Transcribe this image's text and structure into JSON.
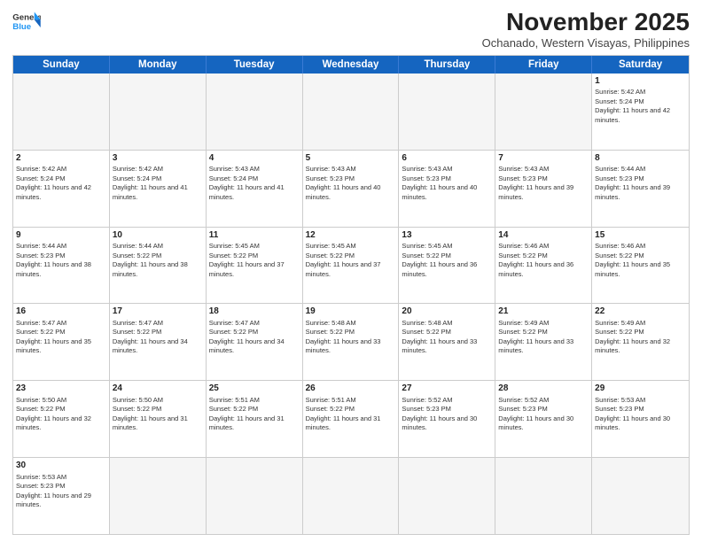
{
  "logo": {
    "line1": "General",
    "line2": "Blue"
  },
  "title": "November 2025",
  "location": "Ochanado, Western Visayas, Philippines",
  "header_days": [
    "Sunday",
    "Monday",
    "Tuesday",
    "Wednesday",
    "Thursday",
    "Friday",
    "Saturday"
  ],
  "weeks": [
    [
      {
        "day": "",
        "empty": true
      },
      {
        "day": "",
        "empty": true
      },
      {
        "day": "",
        "empty": true
      },
      {
        "day": "",
        "empty": true
      },
      {
        "day": "",
        "empty": true
      },
      {
        "day": "",
        "empty": true
      },
      {
        "day": "1",
        "sunrise": "5:42 AM",
        "sunset": "5:24 PM",
        "daylight": "11 hours and 42 minutes."
      }
    ],
    [
      {
        "day": "2",
        "sunrise": "5:42 AM",
        "sunset": "5:24 PM",
        "daylight": "11 hours and 42 minutes."
      },
      {
        "day": "3",
        "sunrise": "5:42 AM",
        "sunset": "5:24 PM",
        "daylight": "11 hours and 41 minutes."
      },
      {
        "day": "4",
        "sunrise": "5:43 AM",
        "sunset": "5:24 PM",
        "daylight": "11 hours and 41 minutes."
      },
      {
        "day": "5",
        "sunrise": "5:43 AM",
        "sunset": "5:23 PM",
        "daylight": "11 hours and 40 minutes."
      },
      {
        "day": "6",
        "sunrise": "5:43 AM",
        "sunset": "5:23 PM",
        "daylight": "11 hours and 40 minutes."
      },
      {
        "day": "7",
        "sunrise": "5:43 AM",
        "sunset": "5:23 PM",
        "daylight": "11 hours and 39 minutes."
      },
      {
        "day": "8",
        "sunrise": "5:44 AM",
        "sunset": "5:23 PM",
        "daylight": "11 hours and 39 minutes."
      }
    ],
    [
      {
        "day": "9",
        "sunrise": "5:44 AM",
        "sunset": "5:23 PM",
        "daylight": "11 hours and 38 minutes."
      },
      {
        "day": "10",
        "sunrise": "5:44 AM",
        "sunset": "5:22 PM",
        "daylight": "11 hours and 38 minutes."
      },
      {
        "day": "11",
        "sunrise": "5:45 AM",
        "sunset": "5:22 PM",
        "daylight": "11 hours and 37 minutes."
      },
      {
        "day": "12",
        "sunrise": "5:45 AM",
        "sunset": "5:22 PM",
        "daylight": "11 hours and 37 minutes."
      },
      {
        "day": "13",
        "sunrise": "5:45 AM",
        "sunset": "5:22 PM",
        "daylight": "11 hours and 36 minutes."
      },
      {
        "day": "14",
        "sunrise": "5:46 AM",
        "sunset": "5:22 PM",
        "daylight": "11 hours and 36 minutes."
      },
      {
        "day": "15",
        "sunrise": "5:46 AM",
        "sunset": "5:22 PM",
        "daylight": "11 hours and 35 minutes."
      }
    ],
    [
      {
        "day": "16",
        "sunrise": "5:47 AM",
        "sunset": "5:22 PM",
        "daylight": "11 hours and 35 minutes."
      },
      {
        "day": "17",
        "sunrise": "5:47 AM",
        "sunset": "5:22 PM",
        "daylight": "11 hours and 34 minutes."
      },
      {
        "day": "18",
        "sunrise": "5:47 AM",
        "sunset": "5:22 PM",
        "daylight": "11 hours and 34 minutes."
      },
      {
        "day": "19",
        "sunrise": "5:48 AM",
        "sunset": "5:22 PM",
        "daylight": "11 hours and 33 minutes."
      },
      {
        "day": "20",
        "sunrise": "5:48 AM",
        "sunset": "5:22 PM",
        "daylight": "11 hours and 33 minutes."
      },
      {
        "day": "21",
        "sunrise": "5:49 AM",
        "sunset": "5:22 PM",
        "daylight": "11 hours and 33 minutes."
      },
      {
        "day": "22",
        "sunrise": "5:49 AM",
        "sunset": "5:22 PM",
        "daylight": "11 hours and 32 minutes."
      }
    ],
    [
      {
        "day": "23",
        "sunrise": "5:50 AM",
        "sunset": "5:22 PM",
        "daylight": "11 hours and 32 minutes."
      },
      {
        "day": "24",
        "sunrise": "5:50 AM",
        "sunset": "5:22 PM",
        "daylight": "11 hours and 31 minutes."
      },
      {
        "day": "25",
        "sunrise": "5:51 AM",
        "sunset": "5:22 PM",
        "daylight": "11 hours and 31 minutes."
      },
      {
        "day": "26",
        "sunrise": "5:51 AM",
        "sunset": "5:22 PM",
        "daylight": "11 hours and 31 minutes."
      },
      {
        "day": "27",
        "sunrise": "5:52 AM",
        "sunset": "5:23 PM",
        "daylight": "11 hours and 30 minutes."
      },
      {
        "day": "28",
        "sunrise": "5:52 AM",
        "sunset": "5:23 PM",
        "daylight": "11 hours and 30 minutes."
      },
      {
        "day": "29",
        "sunrise": "5:53 AM",
        "sunset": "5:23 PM",
        "daylight": "11 hours and 30 minutes."
      }
    ],
    [
      {
        "day": "30",
        "sunrise": "5:53 AM",
        "sunset": "5:23 PM",
        "daylight": "11 hours and 29 minutes."
      },
      {
        "day": "",
        "empty": true
      },
      {
        "day": "",
        "empty": true
      },
      {
        "day": "",
        "empty": true
      },
      {
        "day": "",
        "empty": true
      },
      {
        "day": "",
        "empty": true
      },
      {
        "day": "",
        "empty": true
      }
    ]
  ]
}
